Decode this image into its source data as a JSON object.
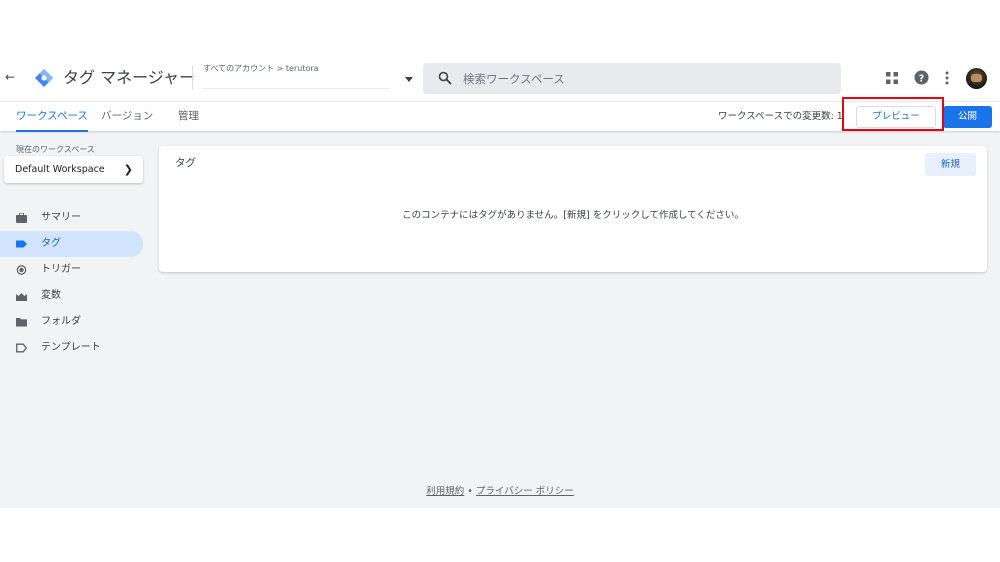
{
  "header": {
    "app_title": "タグ マネージャー",
    "breadcrumb": "すべてのアカウント > terutora",
    "search_placeholder": "検索ワークスペース"
  },
  "tabs": [
    {
      "label": "ワークスペース",
      "active": true
    },
    {
      "label": "バージョン",
      "active": false
    },
    {
      "label": "管理",
      "active": false
    }
  ],
  "toolbar": {
    "changes_text": "ワークスペースでの変更数: 1",
    "preview_label": "プレビュー",
    "publish_label": "公開"
  },
  "sidebar": {
    "current_workspace_label": "現在のワークスペース",
    "workspace_name": "Default Workspace",
    "items": [
      {
        "label": "サマリー",
        "icon": "briefcase-icon",
        "active": false
      },
      {
        "label": "タグ",
        "icon": "tag-icon",
        "active": true
      },
      {
        "label": "トリガー",
        "icon": "trigger-icon",
        "active": false
      },
      {
        "label": "変数",
        "icon": "variables-icon",
        "active": false
      },
      {
        "label": "フォルダ",
        "icon": "folder-icon",
        "active": false
      },
      {
        "label": "テンプレート",
        "icon": "template-icon",
        "active": false
      }
    ]
  },
  "main": {
    "card_title": "タグ",
    "new_label": "新規",
    "empty_message": "このコンテナにはタグがありません。[新規] をクリックして作成してください。"
  },
  "footer": {
    "terms": "利用規約",
    "separator": " • ",
    "privacy": "プライバシー ポリシー"
  },
  "colors": {
    "accent": "#1a73e8",
    "highlight": "#e30613",
    "background": "#f1f3f4",
    "active_nav": "#d2e3fc"
  }
}
